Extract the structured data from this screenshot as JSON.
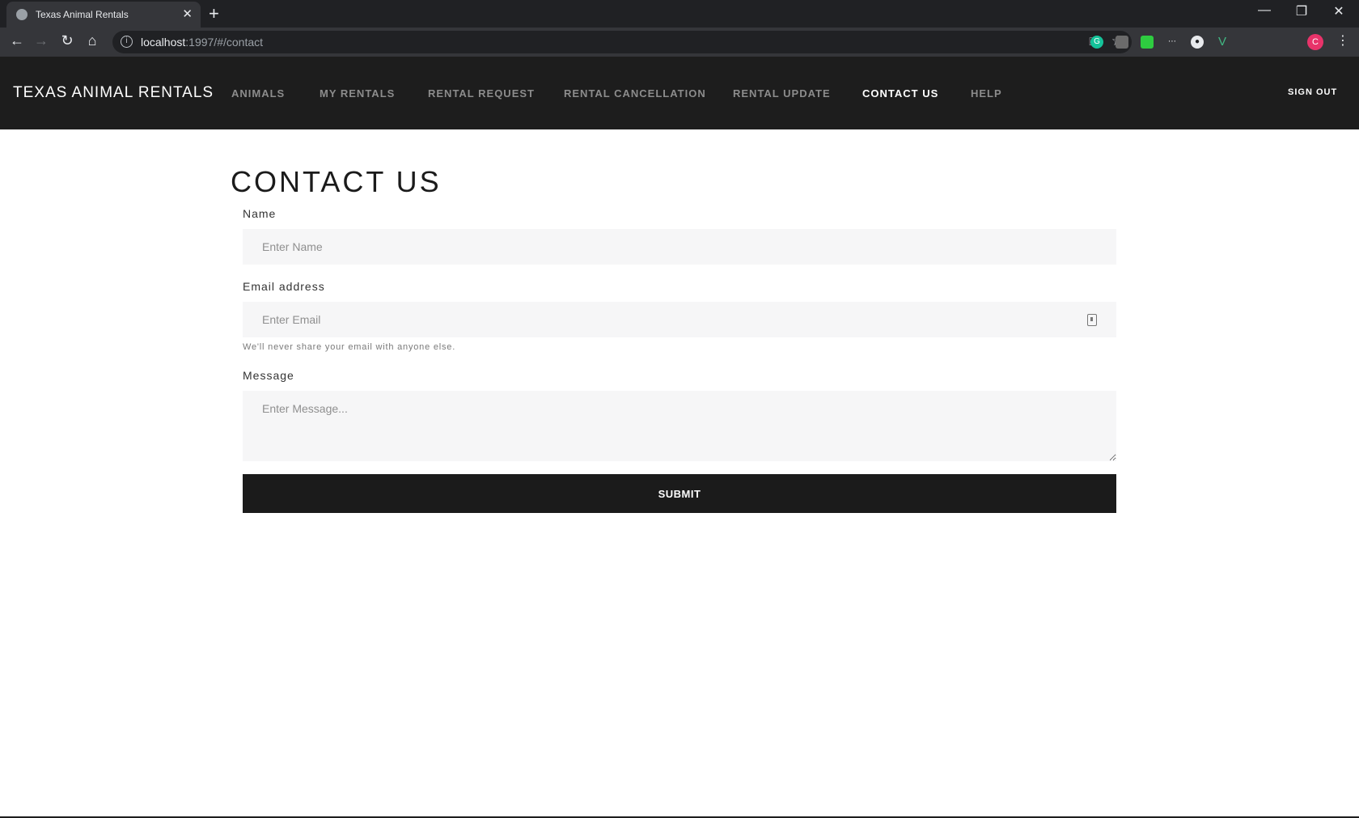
{
  "browser": {
    "tab_title": "Texas Animal Rentals",
    "tab_close": "✕",
    "new_tab": "+",
    "window_controls": {
      "minimize": "—",
      "restore": "❐",
      "close": "✕"
    },
    "url_host": "localhost",
    "url_path": ":1997/#/contact",
    "profile_initial": "C",
    "extension_icons": [
      "grammarly-icon",
      "extension-icon",
      "extension-icon",
      "extension-icon",
      "github-icon",
      "vue-devtools-icon"
    ]
  },
  "nav": {
    "brand": "TEXAS ANIMAL RENTALS",
    "items": [
      {
        "label": "ANIMALS",
        "active": false
      },
      {
        "label": "MY RENTALS",
        "active": false
      },
      {
        "label": "RENTAL REQUEST",
        "active": false
      },
      {
        "label": "RENTAL CANCELLATION",
        "active": false
      },
      {
        "label": "RENTAL UPDATE",
        "active": false
      },
      {
        "label": "CONTACT US",
        "active": true
      },
      {
        "label": "HELP",
        "active": false
      }
    ],
    "sign_out": "SIGN OUT"
  },
  "form": {
    "heading": "CONTACT US",
    "name_label": "Name",
    "name_placeholder": "Enter Name",
    "email_label": "Email address",
    "email_placeholder": "Enter Email",
    "email_help": "We'll never share your email with anyone else.",
    "message_label": "Message",
    "message_placeholder": "Enter Message...",
    "submit_label": "SUBMIT"
  },
  "colors": {
    "nav_background": "#1d1d1d",
    "nav_inactive": "#8c8c8c",
    "nav_active": "#ffffff",
    "field_background": "#f6f6f7",
    "button_background": "#1b1b1b"
  }
}
